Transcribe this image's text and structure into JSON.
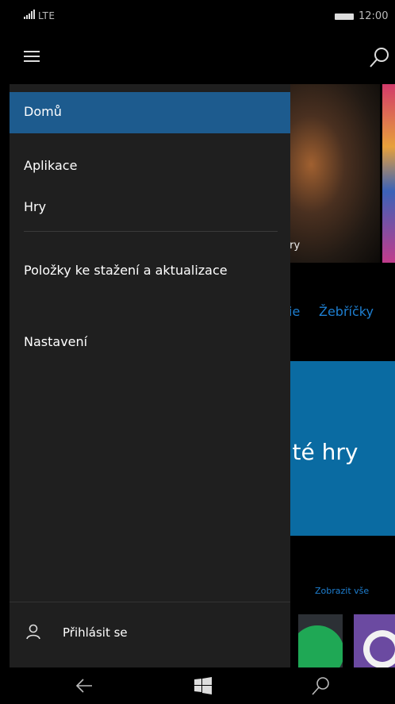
{
  "status_bar": {
    "network": "LTE",
    "time": "12:00",
    "icons": [
      "signal-icon",
      "battery-icon"
    ]
  },
  "header": {
    "icons": [
      "hamburger-icon",
      "search-icon"
    ]
  },
  "drawer": {
    "items": [
      {
        "label": "Domů",
        "active": true
      },
      {
        "label": "Aplikace",
        "active": false
      },
      {
        "label": "Hry",
        "active": false
      },
      {
        "label": "Položky ke stažení a aktualizace",
        "active": false
      },
      {
        "label": "Nastavení",
        "active": false
      }
    ],
    "signin": {
      "label": "Přihlásit se",
      "icon": "person-icon"
    }
  },
  "background": {
    "hero_caption": "cory",
    "pivot_items": [
      "ie",
      "Žebříčky"
    ],
    "promo_text": "žité hry",
    "show_all_link": "Zobrazit vše",
    "accent_color": "#1e7fd1",
    "selection_color": "#1d5b8e"
  },
  "nav_bar": {
    "icons": [
      "back-arrow-icon",
      "windows-start-icon",
      "search-icon"
    ]
  }
}
